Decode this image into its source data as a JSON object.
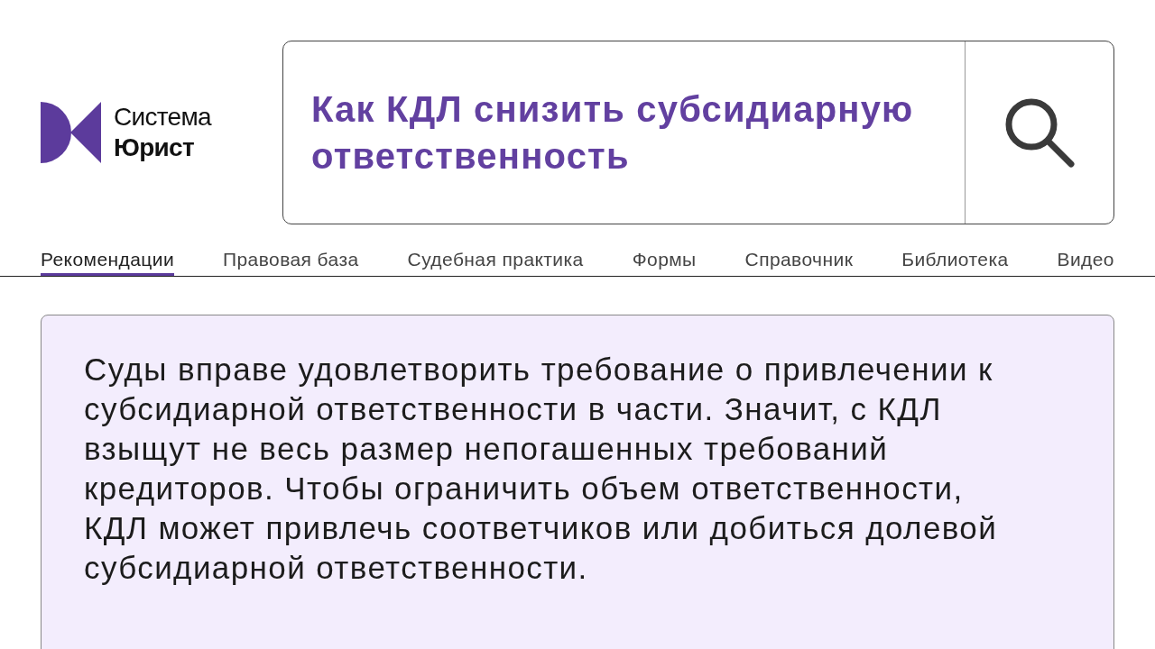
{
  "logo": {
    "line_1": "Система",
    "line_2": "Юрист"
  },
  "search": {
    "value": "Как КДЛ снизить субсидиарную ответственность"
  },
  "tabs": [
    {
      "label": "Рекомендации",
      "selected": true
    },
    {
      "label": "Правовая база",
      "selected": false
    },
    {
      "label": "Судебная практика",
      "selected": false
    },
    {
      "label": "Формы",
      "selected": false
    },
    {
      "label": "Справочник",
      "selected": false
    },
    {
      "label": "Библиотека",
      "selected": false
    },
    {
      "label": "Видео",
      "selected": false
    }
  ],
  "card": {
    "text": "Суды вправе удовлетворить требование о привлечении к субсидиарной ответственности в части. Значит, с КДЛ взыщут не весь размер непогашенных требований кредиторов. Чтобы ограничить объем ответственности, КДЛ может привлечь соответчиков или добиться долевой субсидиарной ответственности."
  }
}
